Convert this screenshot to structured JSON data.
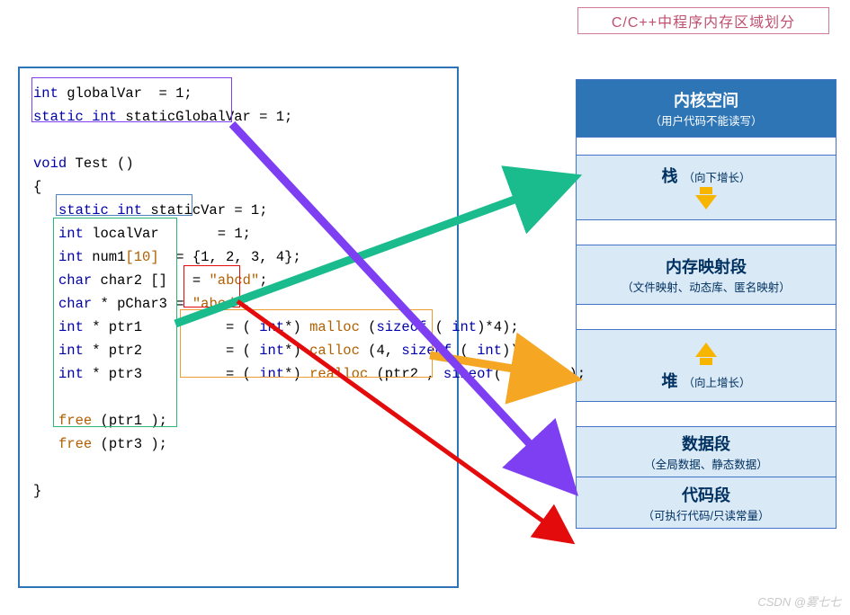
{
  "diagram_title": "C/C++中程序内存区域划分",
  "watermark": "CSDN @雾七七",
  "code": {
    "l1_kw": "int",
    "l1_id": " globalVar",
    "l1_eq": "  = 1;",
    "l2_kw": "static int",
    "l2_id": " staticGlobalVar",
    "l2_eq": " = 1;",
    "l3_kw": "void",
    "l3_id": " Test ()",
    "l4": "{",
    "l5_kw": "static int",
    "l5_id": " staticVar",
    "l5_eq": " = 1;",
    "l6_kw": "int",
    "l6_id": " localVar",
    "l6_eq": "       = 1;",
    "l7_kw": "int",
    "l7_id": " num1",
    "l7_idx": "[10]",
    "l7_eq": "  = {1, 2, 3, 4};",
    "l8_kw": "char",
    "l8_id": " char2 ",
    "l8_br": "[]",
    "l8_eq": "   = ",
    "l8_str": "\"abcd\"",
    "l8_sc": ";",
    "l9_kw": "char",
    "l9_id": " * pChar3 = ",
    "l9_str": "\"abcd\"",
    "l9_sc": ";",
    "l10_kw": "int",
    "l10_id": " * ptr1          = ( ",
    "l10_t": "int",
    "l10_a": "*) ",
    "l10_fn": "malloc",
    "l10_b": " (",
    "l10_sz": "sizeof",
    "l10_c": " ( ",
    "l10_t2": "int",
    "l10_d": ")*4);",
    "l11_kw": "int",
    "l11_id": " * ptr2          = ( ",
    "l11_t": "int",
    "l11_a": "*) ",
    "l11_fn": "calloc",
    "l11_b": " (4, ",
    "l11_sz": "sizeof",
    "l11_c": " ( ",
    "l11_t2": "int",
    "l11_d": "));",
    "l12_kw": "int",
    "l12_id": " * ptr3          = ( ",
    "l12_t": "int",
    "l12_a": "*) ",
    "l12_fn": "realloc",
    "l12_b": " (ptr2 , ",
    "l12_sz": "sizeof",
    "l12_c": "( ",
    "l12_t2": "int",
    "l12_d": " )*4);",
    "l13": "",
    "l14_fn": "free",
    "l14_a": " (ptr1 );",
    "l15_fn": "free",
    "l15_a": " (ptr3 );",
    "l16": "}"
  },
  "mem": {
    "kernel_title": "内核空间",
    "kernel_sub": "（用户代码不能读写）",
    "stack_title": "栈",
    "stack_sub": "（向下增长）",
    "mmap_title": "内存映射段",
    "mmap_sub": "（文件映射、动态库、匿名映射）",
    "heap_title": "堆",
    "heap_sub": "（向上增长）",
    "data_title": "数据段",
    "data_sub": "（全局数据、静态数据）",
    "code_title": "代码段",
    "code_sub": "（可执行代码/只读常量）"
  },
  "arrows": {
    "green": {
      "color": "#1abc8e",
      "desc": "stack-region-pointer"
    },
    "orange": {
      "color": "#f5a623",
      "desc": "heap-region-pointer"
    },
    "purple": {
      "color": "#7e3ff2",
      "desc": "data-segment-pointer"
    },
    "red": {
      "color": "#e30b0b",
      "desc": "code-segment-pointer"
    }
  }
}
